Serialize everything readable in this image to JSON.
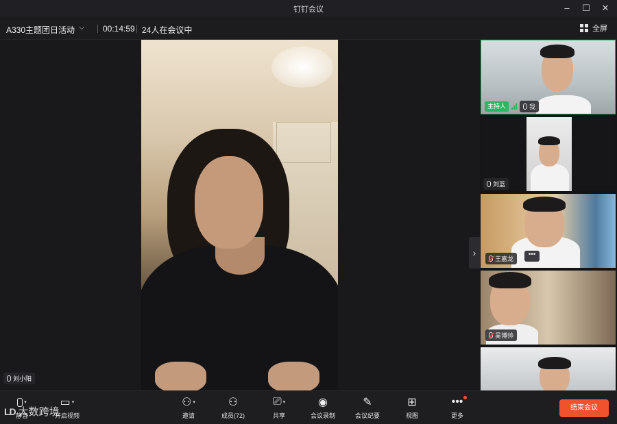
{
  "window": {
    "title": "钉钉会议"
  },
  "infobar": {
    "meeting_name": "A330主题团日活动",
    "timer": "00:14:59",
    "participant_status": "24人在会议中",
    "fullscreen_label": "全屏"
  },
  "main_video": {
    "name": "刘小阳"
  },
  "participants": [
    {
      "badge": "主持人",
      "name": "我"
    },
    {
      "name": "刘蓝"
    },
    {
      "name": "王嘉龙"
    },
    {
      "name": "吴博帅"
    },
    {
      "name": ""
    }
  ],
  "toolbar": {
    "mute_label": "静音",
    "video_label": "开启视频",
    "invite_label": "邀请",
    "members_label": "成员(72)",
    "share_label": "共享",
    "record_label": "会议录制",
    "minutes_label": "会议纪要",
    "view_label": "视图",
    "more_label": "更多",
    "end_label": "结束会议"
  },
  "watermark": {
    "logo": "LD",
    "text": "大数跨境"
  },
  "colors": {
    "host_green": "#2db562",
    "end_red": "#f0522e"
  }
}
